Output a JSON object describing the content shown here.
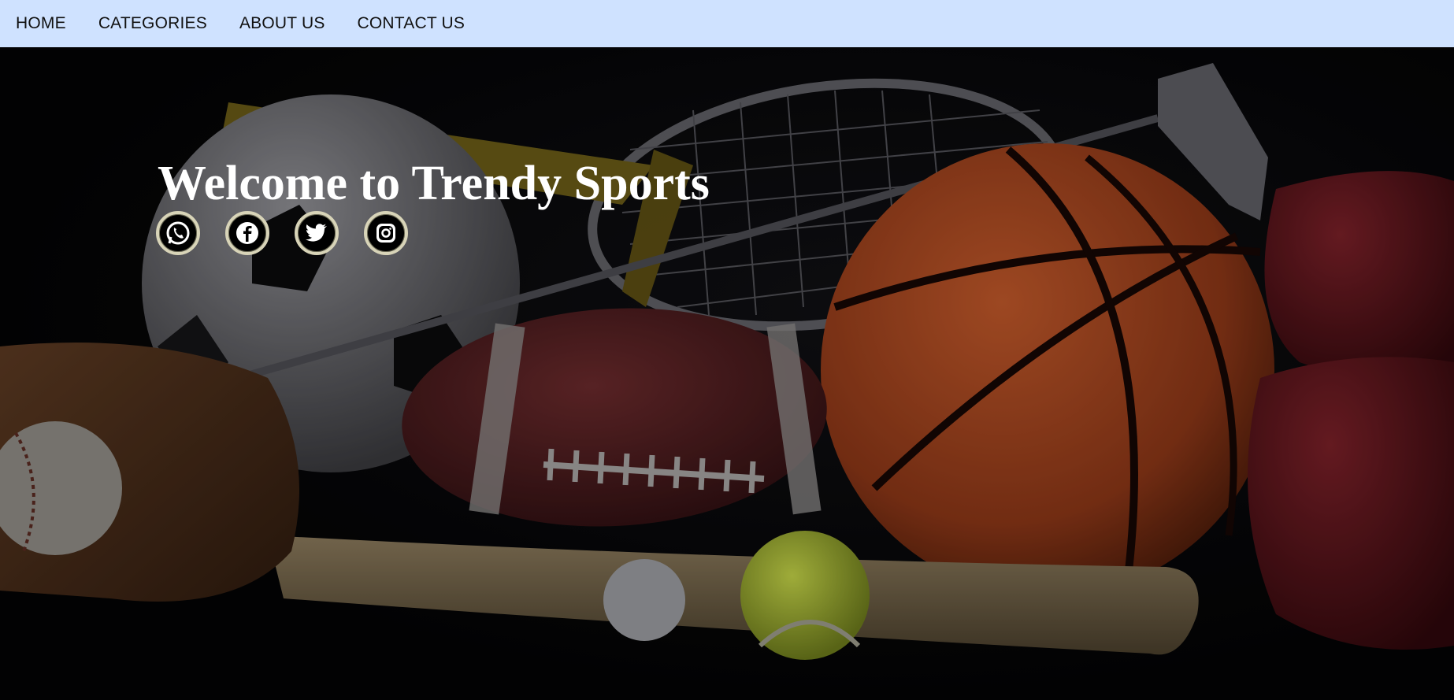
{
  "nav": {
    "home": "HOME",
    "categories": "CATEGORIES",
    "about": "ABOUT US",
    "contact": "CONTACT US"
  },
  "hero": {
    "title": "Welcome to Trendy Sports",
    "image_subject": "sports-equipment-photo"
  },
  "socials": [
    {
      "name": "whatsapp-icon"
    },
    {
      "name": "facebook-icon"
    },
    {
      "name": "twitter-icon"
    },
    {
      "name": "instagram-icon"
    }
  ],
  "colors": {
    "navbar_bg": "#cfe2ff",
    "nav_text": "#111111",
    "hero_title": "#ffffff",
    "icon_ring": "#d8d4b8"
  }
}
